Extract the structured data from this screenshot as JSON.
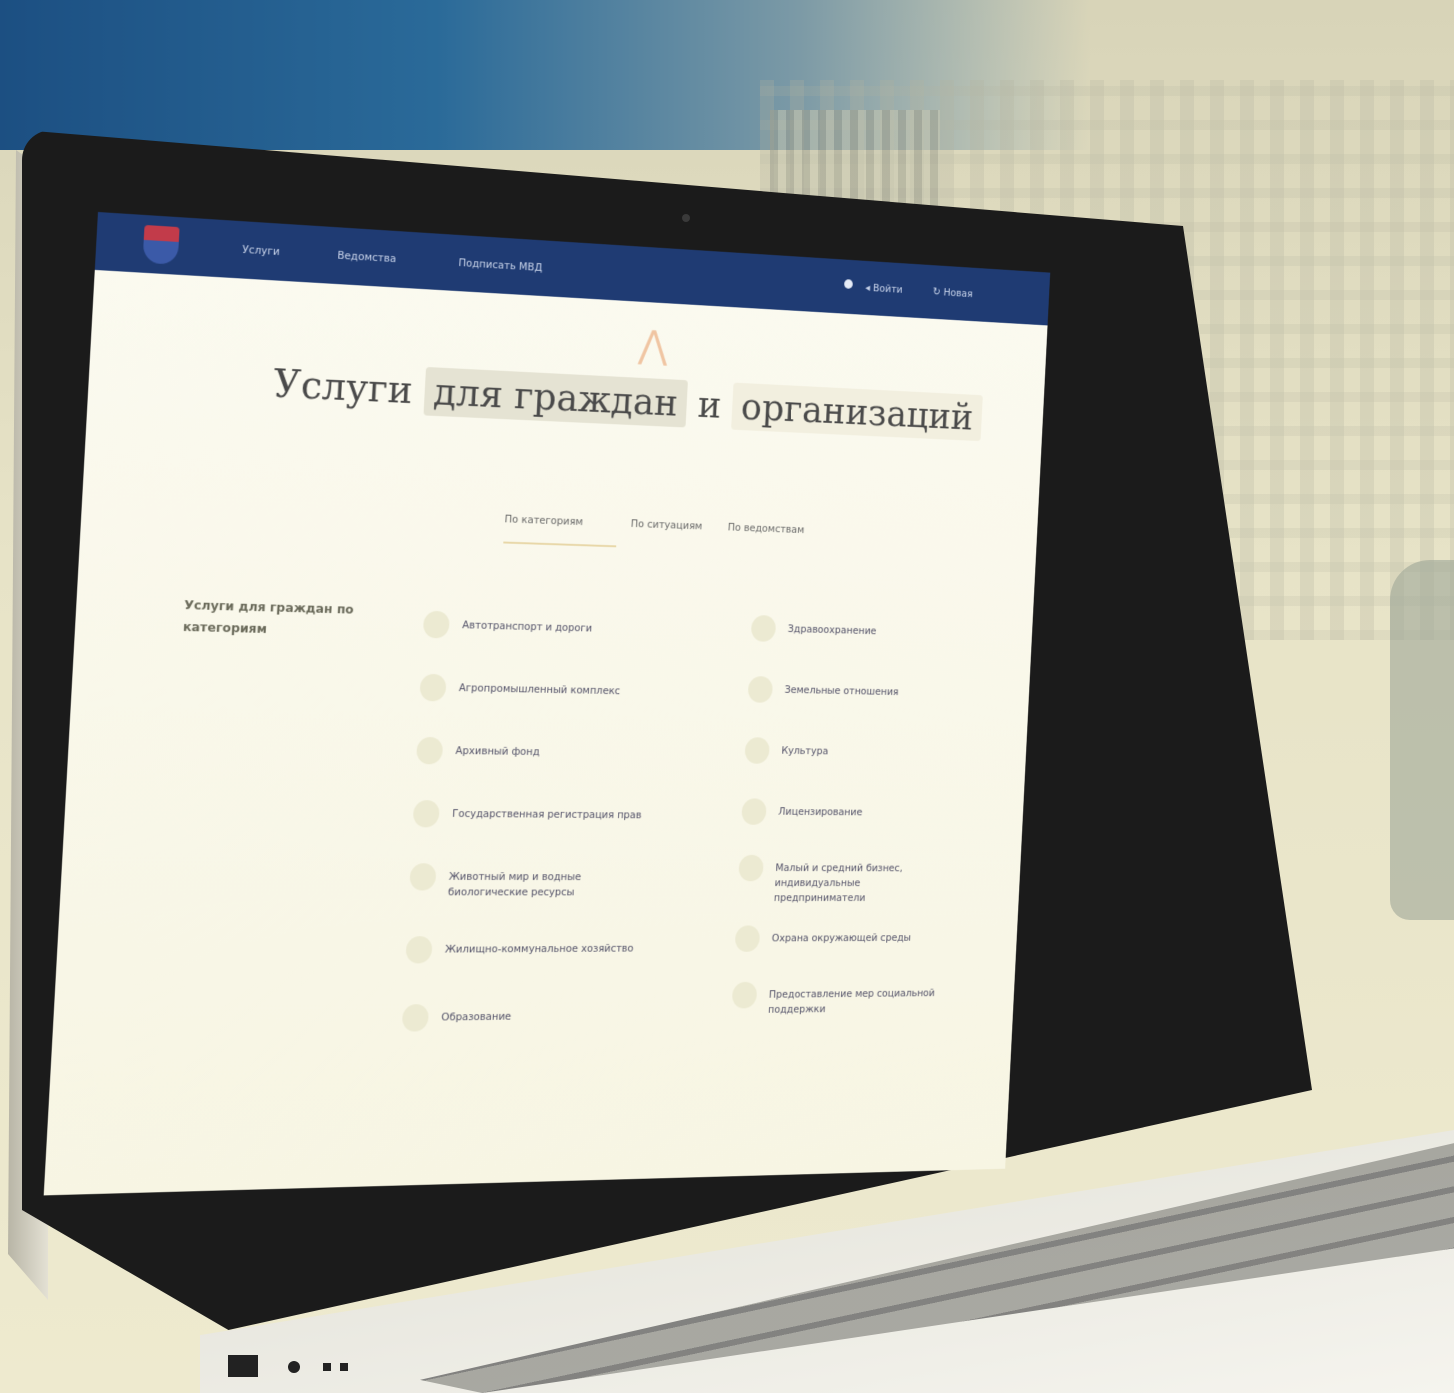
{
  "header": {
    "nav": [
      "Услуги",
      "Ведомства",
      "Подписать МВД"
    ],
    "right": [
      "◂ Войти",
      "↻ Новая"
    ]
  },
  "hero": {
    "part1": "Услуги",
    "part2": "для граждан",
    "part3": "и",
    "part4": "организаций"
  },
  "tabs": [
    "По категориям",
    "По ситуациям",
    "По ведомствам"
  ],
  "sidebar": {
    "title": "Услуги для граждан по категориям"
  },
  "services_left": [
    "Автотранспорт и дороги",
    "Агропромышленный комплекс",
    "Архивный фонд",
    "Государственная регистрация прав",
    "Животный мир и водные биологические ресурсы",
    "Жилищно-коммунальное хозяйство",
    "Образование"
  ],
  "services_right": [
    "Здравоохранение",
    "Земельные отношения",
    "Культура",
    "Лицензирование",
    "Малый и средний бизнес, индивидуальные предприниматели",
    "Охрана окружающей среды",
    "Предоставление мер социальной поддержки"
  ],
  "colors": {
    "nav": "#1f3b73",
    "wall": "#1c4f82"
  }
}
